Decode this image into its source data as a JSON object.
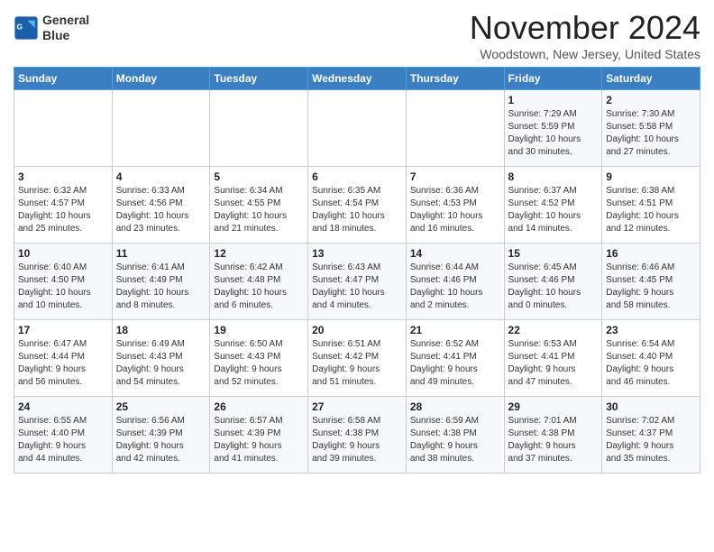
{
  "logo": {
    "line1": "General",
    "line2": "Blue"
  },
  "header": {
    "month": "November 2024",
    "location": "Woodstown, New Jersey, United States"
  },
  "weekdays": [
    "Sunday",
    "Monday",
    "Tuesday",
    "Wednesday",
    "Thursday",
    "Friday",
    "Saturday"
  ],
  "weeks": [
    [
      {
        "day": "",
        "info": ""
      },
      {
        "day": "",
        "info": ""
      },
      {
        "day": "",
        "info": ""
      },
      {
        "day": "",
        "info": ""
      },
      {
        "day": "",
        "info": ""
      },
      {
        "day": "1",
        "info": "Sunrise: 7:29 AM\nSunset: 5:59 PM\nDaylight: 10 hours\nand 30 minutes."
      },
      {
        "day": "2",
        "info": "Sunrise: 7:30 AM\nSunset: 5:58 PM\nDaylight: 10 hours\nand 27 minutes."
      }
    ],
    [
      {
        "day": "3",
        "info": "Sunrise: 6:32 AM\nSunset: 4:57 PM\nDaylight: 10 hours\nand 25 minutes."
      },
      {
        "day": "4",
        "info": "Sunrise: 6:33 AM\nSunset: 4:56 PM\nDaylight: 10 hours\nand 23 minutes."
      },
      {
        "day": "5",
        "info": "Sunrise: 6:34 AM\nSunset: 4:55 PM\nDaylight: 10 hours\nand 21 minutes."
      },
      {
        "day": "6",
        "info": "Sunrise: 6:35 AM\nSunset: 4:54 PM\nDaylight: 10 hours\nand 18 minutes."
      },
      {
        "day": "7",
        "info": "Sunrise: 6:36 AM\nSunset: 4:53 PM\nDaylight: 10 hours\nand 16 minutes."
      },
      {
        "day": "8",
        "info": "Sunrise: 6:37 AM\nSunset: 4:52 PM\nDaylight: 10 hours\nand 14 minutes."
      },
      {
        "day": "9",
        "info": "Sunrise: 6:38 AM\nSunset: 4:51 PM\nDaylight: 10 hours\nand 12 minutes."
      }
    ],
    [
      {
        "day": "10",
        "info": "Sunrise: 6:40 AM\nSunset: 4:50 PM\nDaylight: 10 hours\nand 10 minutes."
      },
      {
        "day": "11",
        "info": "Sunrise: 6:41 AM\nSunset: 4:49 PM\nDaylight: 10 hours\nand 8 minutes."
      },
      {
        "day": "12",
        "info": "Sunrise: 6:42 AM\nSunset: 4:48 PM\nDaylight: 10 hours\nand 6 minutes."
      },
      {
        "day": "13",
        "info": "Sunrise: 6:43 AM\nSunset: 4:47 PM\nDaylight: 10 hours\nand 4 minutes."
      },
      {
        "day": "14",
        "info": "Sunrise: 6:44 AM\nSunset: 4:46 PM\nDaylight: 10 hours\nand 2 minutes."
      },
      {
        "day": "15",
        "info": "Sunrise: 6:45 AM\nSunset: 4:46 PM\nDaylight: 10 hours\nand 0 minutes."
      },
      {
        "day": "16",
        "info": "Sunrise: 6:46 AM\nSunset: 4:45 PM\nDaylight: 9 hours\nand 58 minutes."
      }
    ],
    [
      {
        "day": "17",
        "info": "Sunrise: 6:47 AM\nSunset: 4:44 PM\nDaylight: 9 hours\nand 56 minutes."
      },
      {
        "day": "18",
        "info": "Sunrise: 6:49 AM\nSunset: 4:43 PM\nDaylight: 9 hours\nand 54 minutes."
      },
      {
        "day": "19",
        "info": "Sunrise: 6:50 AM\nSunset: 4:43 PM\nDaylight: 9 hours\nand 52 minutes."
      },
      {
        "day": "20",
        "info": "Sunrise: 6:51 AM\nSunset: 4:42 PM\nDaylight: 9 hours\nand 51 minutes."
      },
      {
        "day": "21",
        "info": "Sunrise: 6:52 AM\nSunset: 4:41 PM\nDaylight: 9 hours\nand 49 minutes."
      },
      {
        "day": "22",
        "info": "Sunrise: 6:53 AM\nSunset: 4:41 PM\nDaylight: 9 hours\nand 47 minutes."
      },
      {
        "day": "23",
        "info": "Sunrise: 6:54 AM\nSunset: 4:40 PM\nDaylight: 9 hours\nand 46 minutes."
      }
    ],
    [
      {
        "day": "24",
        "info": "Sunrise: 6:55 AM\nSunset: 4:40 PM\nDaylight: 9 hours\nand 44 minutes."
      },
      {
        "day": "25",
        "info": "Sunrise: 6:56 AM\nSunset: 4:39 PM\nDaylight: 9 hours\nand 42 minutes."
      },
      {
        "day": "26",
        "info": "Sunrise: 6:57 AM\nSunset: 4:39 PM\nDaylight: 9 hours\nand 41 minutes."
      },
      {
        "day": "27",
        "info": "Sunrise: 6:58 AM\nSunset: 4:38 PM\nDaylight: 9 hours\nand 39 minutes."
      },
      {
        "day": "28",
        "info": "Sunrise: 6:59 AM\nSunset: 4:38 PM\nDaylight: 9 hours\nand 38 minutes."
      },
      {
        "day": "29",
        "info": "Sunrise: 7:01 AM\nSunset: 4:38 PM\nDaylight: 9 hours\nand 37 minutes."
      },
      {
        "day": "30",
        "info": "Sunrise: 7:02 AM\nSunset: 4:37 PM\nDaylight: 9 hours\nand 35 minutes."
      }
    ]
  ]
}
